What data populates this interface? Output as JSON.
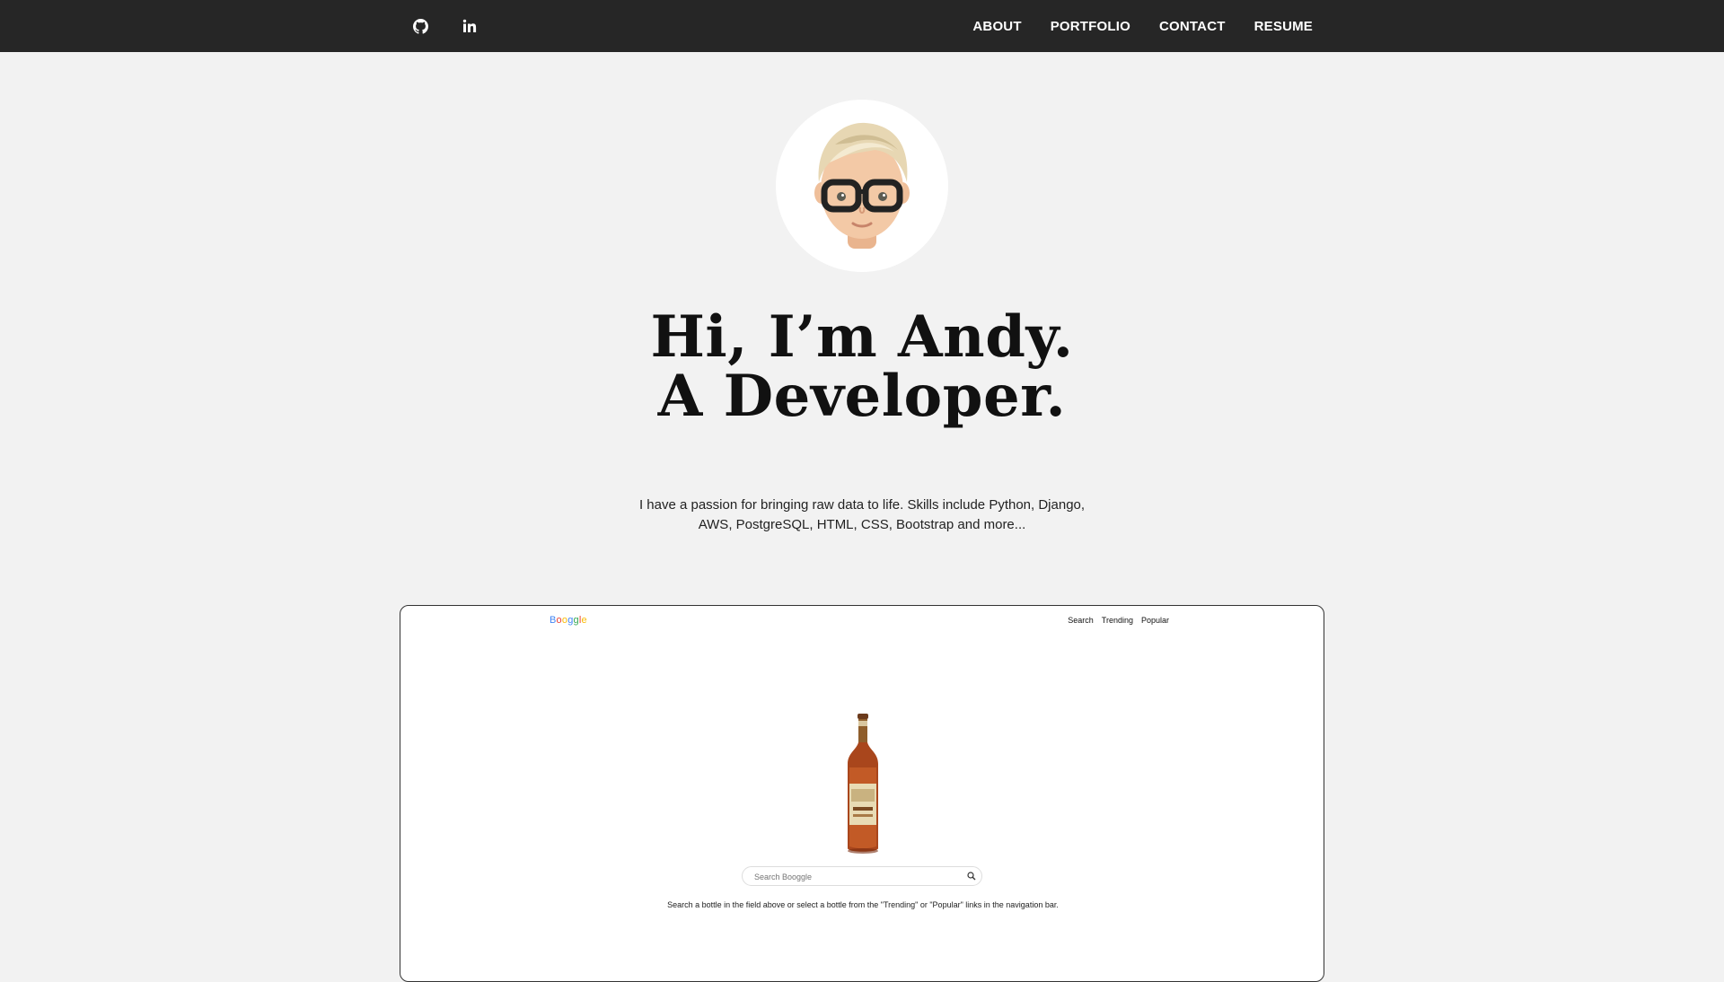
{
  "nav": {
    "social": [
      {
        "icon": "github-icon"
      },
      {
        "icon": "linkedin-icon"
      }
    ],
    "links": [
      "ABOUT",
      "PORTFOLIO",
      "CONTACT",
      "RESUME"
    ]
  },
  "hero": {
    "line1": "Hi, I’m Andy.",
    "line2": "A Developer.",
    "intro": "I have a passion for bringing raw data to life. Skills include Python, Django, AWS, PostgreSQL, HTML, CSS, Bootstrap and more..."
  },
  "preview": {
    "logo": "Booggle",
    "nav": [
      "Search",
      "Trending",
      "Popular"
    ],
    "search_placeholder": "Search Booggle",
    "help": "Search a bottle in the field above or select a bottle from the \"Trending\" or \"Popular\" links in the navigation bar."
  },
  "colors": {
    "topbar": "#262626",
    "page_bg": "#f2f2f2",
    "logo_blue": "#4285f4",
    "logo_red": "#ea4335",
    "logo_yellow": "#fbbc05",
    "logo_green": "#34a853"
  }
}
